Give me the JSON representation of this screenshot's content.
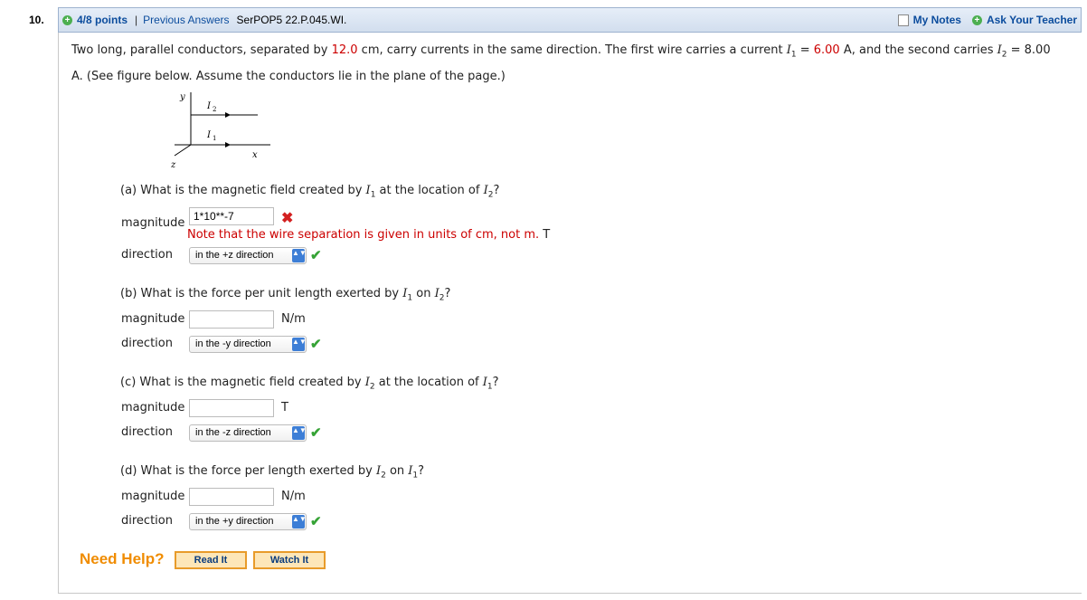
{
  "header": {
    "question_number": "10.",
    "points": "4/8 points",
    "separator": "|",
    "previous_answers": "Previous Answers",
    "problem_code": "SerPOP5 22.P.045.WI.",
    "my_notes": "My Notes",
    "ask_teacher": "Ask Your Teacher"
  },
  "question": {
    "t1": "Two long, parallel conductors, separated by ",
    "sep_value": "12.0",
    "t2": " cm, carry currents in the same direction. The first wire carries a current ",
    "i1_sym": "I",
    "i1_sub": "1",
    "eq1": " = ",
    "i1_value": "6.00",
    "t3": " A, and the second carries ",
    "i2_sym": "I",
    "i2_sub": "2",
    "eq2": " = 8.00",
    "t4": "A. (See figure below. Assume the conductors lie in the plane of the page.)"
  },
  "figure": {
    "y_label": "y",
    "z_label": "z",
    "x_label": "x",
    "i1_label": "I",
    "i1_sub": "1",
    "i2_label": "I",
    "i2_sub": "2"
  },
  "parts": {
    "a": {
      "q1": "(a) What is the magnetic field created by ",
      "s1": "I",
      "sub1": "1",
      "q2": " at the location of ",
      "s2": "I",
      "sub2": "2",
      "q3": "?",
      "magnitude_label": "magnitude",
      "magnitude_value": "1*10**-7",
      "hint_text": "Note that the wire separation is given in units of cm, not m.",
      "unit": "T",
      "direction_label": "direction",
      "direction_value": "in the +z direction"
    },
    "b": {
      "q1": "(b) What is the force per unit length exerted by ",
      "s1": "I",
      "sub1": "1",
      "q2": " on ",
      "s2": "I",
      "sub2": "2",
      "q3": "?",
      "magnitude_label": "magnitude",
      "magnitude_value": "",
      "unit": "N/m",
      "direction_label": "direction",
      "direction_value": "in the -y direction"
    },
    "c": {
      "q1": "(c) What is the magnetic field created by ",
      "s1": "I",
      "sub1": "2",
      "q2": " at the location of ",
      "s2": "I",
      "sub2": "1",
      "q3": "?",
      "magnitude_label": "magnitude",
      "magnitude_value": "",
      "unit": "T",
      "direction_label": "direction",
      "direction_value": "in the -z direction"
    },
    "d": {
      "q1": "(d) What is the force per length exerted by ",
      "s1": "I",
      "sub1": "2",
      "q2": " on ",
      "s2": "I",
      "sub2": "1",
      "q3": "?",
      "magnitude_label": "magnitude",
      "magnitude_value": "",
      "unit": "N/m",
      "direction_label": "direction",
      "direction_value": "in the +y direction"
    }
  },
  "help": {
    "label": "Need Help?",
    "read_it": "Read It",
    "watch_it": "Watch It"
  },
  "icons": {
    "plus": "+",
    "cross": "✖",
    "check": "✔",
    "select_arrows": "▲▼"
  },
  "colors": {
    "accent_blue": "#0b4c9d",
    "error_red": "#cc0000",
    "correct_green": "#36a336",
    "help_orange": "#f08c00"
  }
}
